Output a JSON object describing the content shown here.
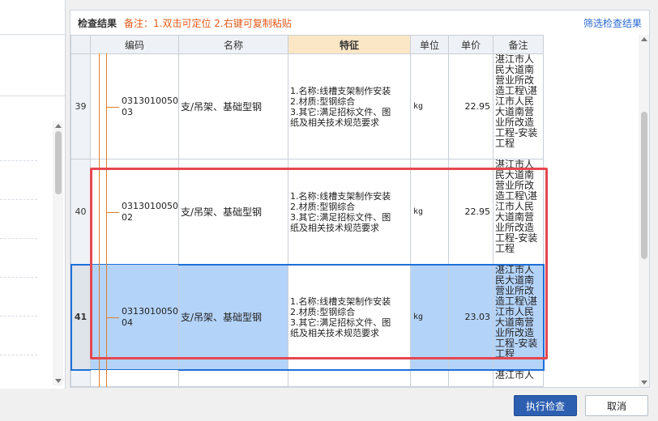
{
  "panel": {
    "title": "检查结果",
    "note": "备注：1.双击可定位 2.右键可复制粘贴",
    "filter_link": "筛选检查结果"
  },
  "table": {
    "headers": {
      "col0": "",
      "code": "编码",
      "name": "名称",
      "feature": "特征",
      "unit": "单位",
      "price": "单价",
      "remark": "备注"
    },
    "rows": [
      {
        "num": "39",
        "code_l1": "0313010050",
        "code_l2": "03",
        "name": "支/吊架、基础型钢",
        "f1": "1.名称:线槽支架制作安装",
        "f2": "2.材质:型钢综合",
        "f3": "3.其它:满足招标文件、图",
        "f4": "纸及相关技术规范要求",
        "unit": "kg",
        "price": "22.95",
        "remark": "湛江市人民大道南营业所改造工程\\湛江市人民大道南营业所改造工程-安装工程"
      },
      {
        "num": "40",
        "code_l1": "0313010050",
        "code_l2": "02",
        "name": "支/吊架、基础型钢",
        "f1": "1.名称:线槽支架制作安装",
        "f2": "2.材质:型钢综合",
        "f3": "3.其它:满足招标文件、图",
        "f4": "纸及相关技术规范要求",
        "unit": "kg",
        "price": "22.95",
        "remark": "湛江市人民大道南营业所改造工程\\湛江市人民大道南营业所改造工程-安装工程"
      },
      {
        "num": "41",
        "code_l1": "0313010050",
        "code_l2": "04",
        "name": "支/吊架、基础型钢",
        "f1": "1.名称:线槽支架制作安装",
        "f2": "2.材质:型钢综合",
        "f3": "3.其它:满足招标文件、图",
        "f4": "纸及相关技术规范要求",
        "unit": "kg",
        "price": "23.03",
        "remark": "湛江市人民大道南营业所改造工程\\湛江市人民大道南营业所改造工程-安装工程"
      }
    ],
    "partial_remark": "湛江市人"
  },
  "buttons": {
    "execute": "执行检查",
    "cancel": "取消"
  },
  "colors": {
    "accent": "#2d5fb1",
    "note": "#e05a1a",
    "selection": "#b4d3f9",
    "highlight": "#e4474f"
  }
}
